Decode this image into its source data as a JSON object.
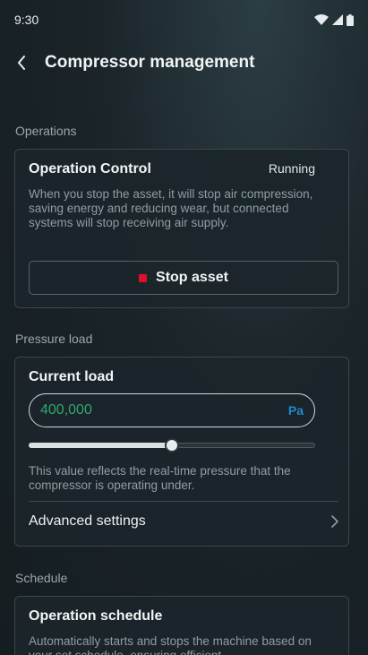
{
  "status_bar": {
    "time": "9:30",
    "icons": [
      "wifi-icon",
      "signal-icon",
      "battery-icon"
    ]
  },
  "header": {
    "title": "Compressor management",
    "back_icon": "chevron-left-icon"
  },
  "operations": {
    "section_label": "Operations",
    "title": "Operation Control",
    "status": "Running",
    "description": "When you stop the asset, it will stop air compression, saving energy and reducing wear, but connected systems will stop receiving air supply.",
    "stop_button_label": "Stop asset",
    "stop_color": "#e0102a"
  },
  "pressure_load": {
    "section_label": "Pressure load",
    "title": "Current load",
    "value": "400,000",
    "unit": "Pa",
    "slider_fraction": 0.5,
    "description": "This value reflects the real-time pressure that the compressor is operating under.",
    "advanced_label": "Advanced settings"
  },
  "schedule": {
    "section_label": "Schedule",
    "title": "Operation schedule",
    "description": "Automatically starts and stops the machine based on your set schedule, ensuring efficient"
  },
  "colors": {
    "accent_green": "#2ea86e",
    "unit_blue": "#1e8bd0",
    "background": "#1a2429"
  }
}
